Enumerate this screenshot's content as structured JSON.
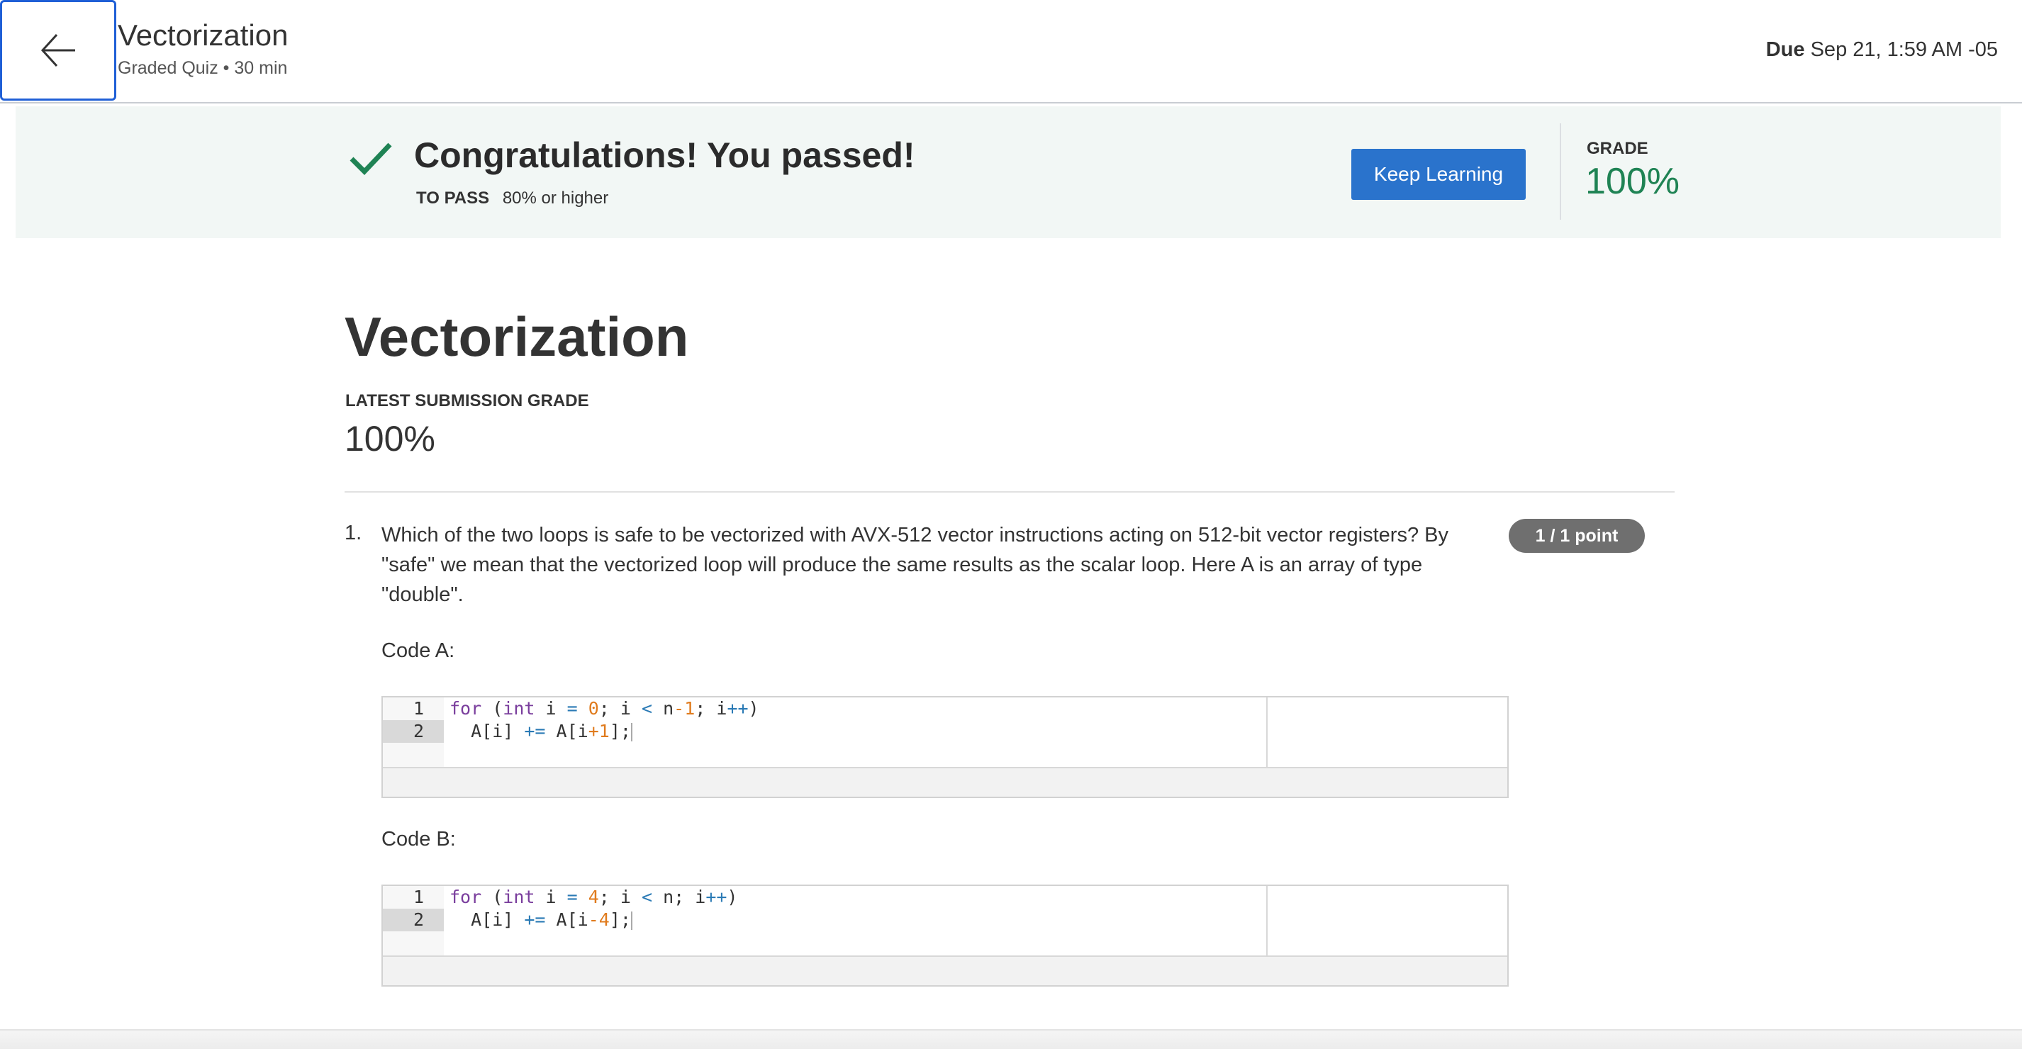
{
  "header": {
    "title": "Vectorization",
    "subtitle": "Graded Quiz • 30 min",
    "due_label": "Due",
    "due_value": "Sep 21, 1:59 AM -05"
  },
  "banner": {
    "message": "Congratulations! You passed!",
    "to_pass_label": "TO PASS",
    "to_pass_value": "80% or higher",
    "keep_learning": "Keep Learning",
    "grade_label": "GRADE",
    "grade_value": "100%"
  },
  "main": {
    "title": "Vectorization",
    "latest_label": "LATEST SUBMISSION GRADE",
    "latest_value": "100%"
  },
  "question": {
    "number": "1.",
    "text": "Which of the two loops is safe to be vectorized with AVX-512 vector instructions acting on 512-bit vector registers? By \"safe\" we mean that the vectorized loop will produce the same results as the scalar loop. Here A is an array of type \"double\".",
    "points": "1 / 1 point",
    "code_a_label": "Code A:",
    "code_b_label": "Code B:",
    "code_a": {
      "line_numbers": [
        "1",
        "2"
      ],
      "lines": [
        "for (int i = 0; i < n-1; i++)",
        "  A[i] += A[i+1];"
      ]
    },
    "code_b": {
      "line_numbers": [
        "1",
        "2"
      ],
      "lines": [
        "for (int i = 4; i < n; i++)",
        "  A[i] += A[i-4];"
      ]
    }
  },
  "icons": {
    "back": "arrow-left-icon",
    "check": "checkmark-icon"
  },
  "colors": {
    "accent_blue": "#2a73cc",
    "success_green": "#1f8354",
    "banner_bg": "#f2f7f5",
    "points_badge": "#6f6f6f"
  }
}
